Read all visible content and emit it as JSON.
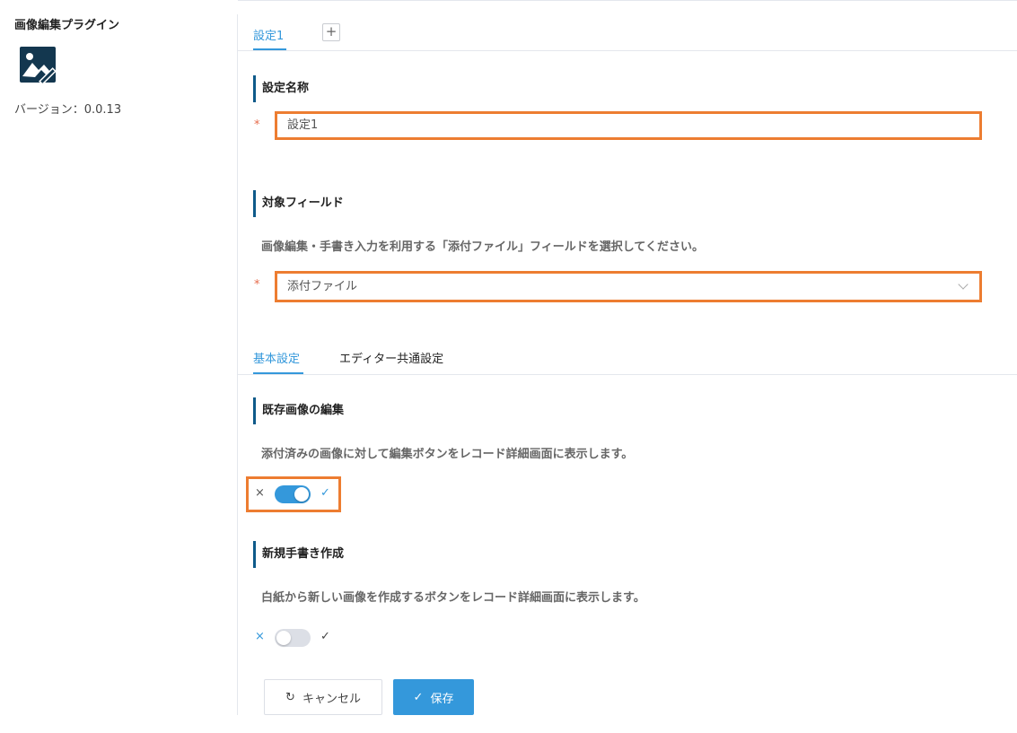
{
  "sidebar": {
    "title": "画像編集プラグイン",
    "version": "バージョン：0.0.13",
    "logo_icon": "image-edit-icon"
  },
  "config_tabs": {
    "active": "設定1",
    "add_label": "+"
  },
  "settings_name": {
    "label": "設定名称",
    "required_mark": "*",
    "value": "設定1"
  },
  "target_field": {
    "label": "対象フィールド",
    "description": "画像編集・手書き入力を利用する「添付ファイル」フィールドを選択してください。",
    "required_mark": "*",
    "value": "添付ファイル"
  },
  "sub_tabs": {
    "basic": "基本設定",
    "editor_common": "エディター共通設定"
  },
  "edit_existing": {
    "label": "既存画像の編集",
    "description": "添付済みの画像に対して編集ボタンをレコード詳細画面に表示します。",
    "enabled": true,
    "off_symbol": "×",
    "on_symbol": "✓"
  },
  "new_handwriting": {
    "label": "新規手書き作成",
    "description": "白紙から新しい画像を作成するボタンをレコード詳細画面に表示します。",
    "enabled": false,
    "off_symbol": "×",
    "on_symbol": "✓"
  },
  "buttons": {
    "cancel": "キャンセル",
    "save": "保存"
  },
  "colors": {
    "accent": "#3498db",
    "highlight": "#ed7d31",
    "section_bar": "#0e5a8a",
    "required": "#e66b4c"
  }
}
